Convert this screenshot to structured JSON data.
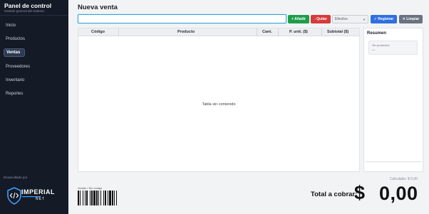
{
  "sidebar": {
    "title": "Panel de control",
    "subtitle": "Gestión general del sistema",
    "items": [
      {
        "label": "Inicio",
        "active": false
      },
      {
        "label": "Productos",
        "active": false
      },
      {
        "label": "Ventas",
        "active": true
      },
      {
        "label": "Proveedores",
        "active": false
      },
      {
        "label": "Inventario",
        "active": false
      },
      {
        "label": "Reportes",
        "active": false
      }
    ],
    "developed_by": "Desarrollado por",
    "logo": {
      "text": "IMPERIAL",
      "subtext": "NET",
      "icon": "code-shield-icon"
    }
  },
  "main": {
    "title": "Nueva venta",
    "search": {
      "value": "",
      "placeholder": ""
    },
    "buttons": {
      "add": "+ Añadir",
      "remove": "- Quitar",
      "register": "✓ Registrar",
      "clear": "✕ Limpiar"
    },
    "payment_select": {
      "selected": "Efectivo",
      "icon": "chevron-down-icon"
    },
    "table": {
      "columns": [
        "Código",
        "Producto",
        "Cant.",
        "P. unit. ($)",
        "Subtotal ($)"
      ],
      "rows": [],
      "empty_text": "Tabla sin contenido"
    }
  },
  "summary": {
    "title": "Resumen",
    "box_label": "Sin productos",
    "box_value": "—"
  },
  "footer": {
    "calculated": "Calculado:  $ 0,00",
    "barcode_label": "Ventas / Sin código",
    "total_label": "Total a cobrar:",
    "currency": "$",
    "total_value": "0,00"
  },
  "colors": {
    "sidebar_bg": "#141a26",
    "add": "#1e9e4a",
    "remove": "#d63a3a",
    "register": "#2f6fe0",
    "clear": "#6b7280",
    "focus": "#3aa3d6"
  }
}
